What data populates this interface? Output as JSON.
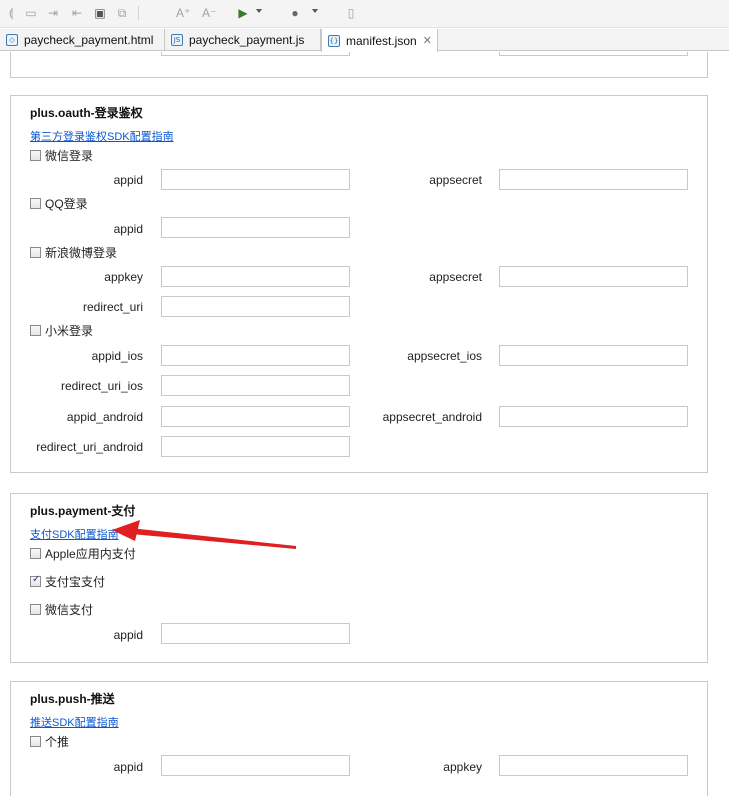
{
  "tabs": [
    {
      "label": "paycheck_payment.html",
      "icon": "html-file-icon"
    },
    {
      "label": "paycheck_payment.js",
      "icon": "js-file-icon"
    },
    {
      "label": "manifest.json",
      "icon": "json-file-icon",
      "active": true,
      "close": "✕"
    }
  ],
  "oauth": {
    "title": "plus.oauth-登录鉴权",
    "link": "第三方登录鉴权SDK配置指南",
    "weixin": {
      "label": "微信登录",
      "checked": false,
      "f1": "appid",
      "f2": "appsecret"
    },
    "qq": {
      "label": "QQ登录",
      "checked": false,
      "f1": "appid"
    },
    "sina": {
      "label": "新浪微博登录",
      "checked": false,
      "f1": "appkey",
      "f2": "appsecret",
      "f3": "redirect_uri"
    },
    "xiaomi": {
      "label": "小米登录",
      "checked": false,
      "f1": "appid_ios",
      "f2": "appsecret_ios",
      "f3": "redirect_uri_ios",
      "f4": "appid_android",
      "f5": "appsecret_android",
      "f6": "redirect_uri_android"
    }
  },
  "payment": {
    "title": "plus.payment-支付",
    "link": "支付SDK配置指南",
    "apple": {
      "label": "Apple应用内支付",
      "checked": false
    },
    "alipay": {
      "label": "支付宝支付",
      "checked": true
    },
    "weixin": {
      "label": "微信支付",
      "checked": false,
      "f1": "appid"
    }
  },
  "push": {
    "title": "plus.push-推送",
    "link": "推送SDK配置指南",
    "getui": {
      "label": "个推",
      "checked": false,
      "f1": "appid",
      "f2": "appkey"
    }
  },
  "annotation_color": "#e02020"
}
